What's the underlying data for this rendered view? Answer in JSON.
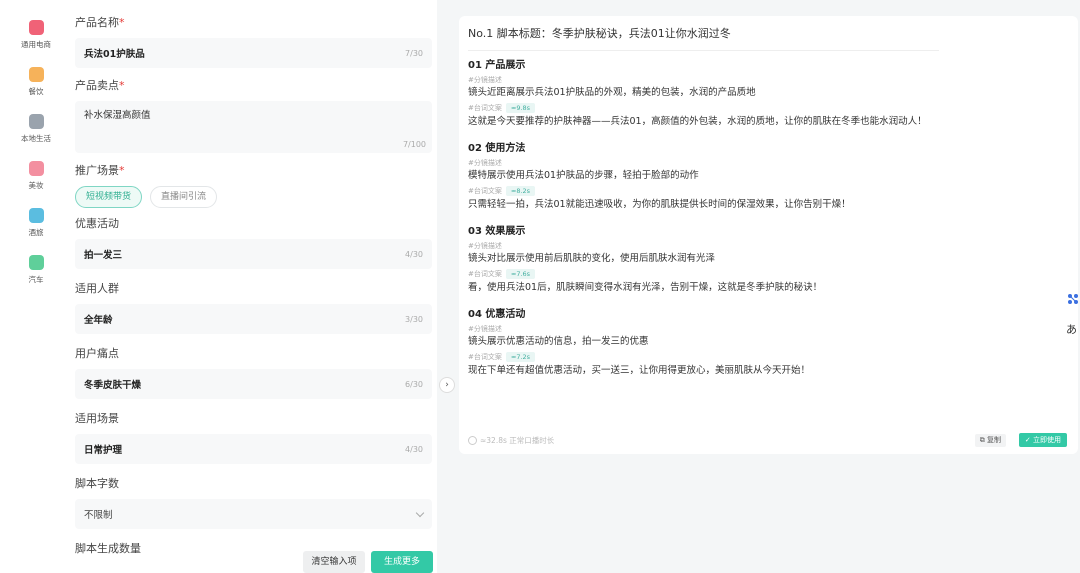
{
  "nav": {
    "items": [
      {
        "label": "通用电商",
        "color": "#f06277"
      },
      {
        "label": "餐饮",
        "color": "#f6b25a"
      },
      {
        "label": "本地生活",
        "color": "#9aa3ad"
      },
      {
        "label": "美妆",
        "color": "#f38fa0"
      },
      {
        "label": "酒旅",
        "color": "#5bbde0"
      },
      {
        "label": "汽车",
        "color": "#5fcf9a"
      }
    ]
  },
  "form": {
    "product_name": {
      "label": "产品名称",
      "value": "兵法01护肤品",
      "count": "7/30"
    },
    "selling_point": {
      "label": "产品卖点",
      "value": "补水保湿高颜值",
      "count": "7/100"
    },
    "scene": {
      "label": "推广场景",
      "tabs": [
        "短视频带货",
        "直播间引流"
      ]
    },
    "promotion": {
      "label": "优惠活动",
      "value": "拍一发三",
      "count": "4/30"
    },
    "audience": {
      "label": "适用人群",
      "value": "全年龄",
      "count": "3/30"
    },
    "pain_point": {
      "label": "用户痛点",
      "value": "冬季皮肤干燥",
      "count": "6/30"
    },
    "use_scene": {
      "label": "适用场景",
      "value": "日常护理",
      "count": "4/30"
    },
    "word_count": {
      "label": "脚本字数",
      "value": "不限制"
    },
    "gen_count": {
      "label": "脚本生成数量"
    }
  },
  "buttons": {
    "clear": "清空输入项",
    "generate": "生成更多"
  },
  "result": {
    "title": "No.1 脚本标题：冬季护肤秘诀，兵法01让你水润过冬",
    "shot_label": "#分镜描述",
    "copy_label": "#台词文案",
    "sections": [
      {
        "title": "01 产品展示",
        "shot": "镜头近距离展示兵法01护肤品的外观，精美的包装，水润的产品质地",
        "duration": "≈9.8s",
        "copy": "这就是今天要推荐的护肤神器——兵法01，高颜值的外包装，水润的质地，让你的肌肤在冬季也能水润动人！"
      },
      {
        "title": "02 使用方法",
        "shot": "模特展示使用兵法01护肤品的步骤，轻拍于脸部的动作",
        "duration": "≈8.2s",
        "copy": "只需轻轻一拍，兵法01就能迅速吸收，为你的肌肤提供长时间的保湿效果，让你告别干燥！"
      },
      {
        "title": "03 效果展示",
        "shot": "镜头对比展示使用前后肌肤的变化，使用后肌肤水润有光泽",
        "duration": "≈7.6s",
        "copy": "看，使用兵法01后，肌肤瞬间变得水润有光泽，告别干燥，这就是冬季护肤的秘诀！"
      },
      {
        "title": "04 优惠活动",
        "shot": "镜头展示优惠活动的信息，拍一发三的优惠",
        "duration": "≈7.2s",
        "copy": "现在下单还有超值优惠活动，买一送三，让你用得更放心，美丽肌肤从今天开始！"
      }
    ],
    "footer_note": "≈32.8s 正常口播时长",
    "copy_button": "复制",
    "use_button": "立即使用"
  },
  "side": {
    "translate_glyph": "あ"
  },
  "colors": {
    "accent": "#33c9a6",
    "required": "#e53935"
  }
}
